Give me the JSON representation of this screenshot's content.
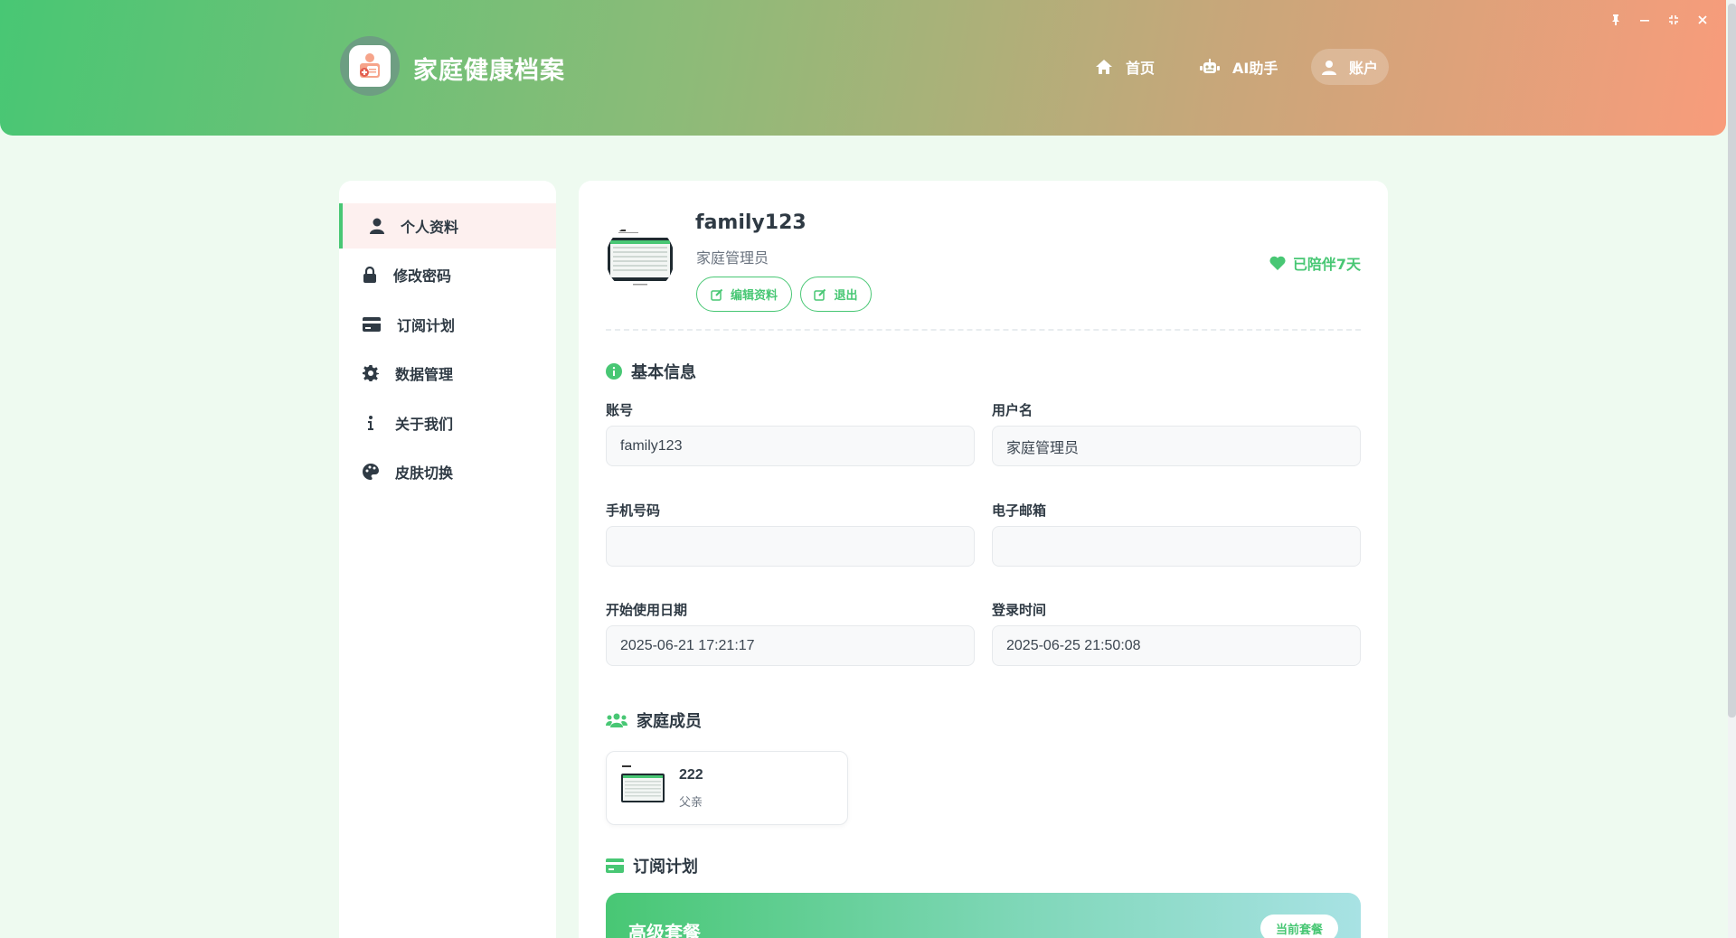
{
  "header": {
    "brand": "家庭健康档案",
    "nav": {
      "home": "首页",
      "ai": "AI助手",
      "account": "账户"
    },
    "window_controls": [
      "pin-icon",
      "minimize-icon",
      "restore-icon",
      "close-icon"
    ]
  },
  "sidebar": {
    "items": [
      {
        "label": "个人资料",
        "icon": "user-icon"
      },
      {
        "label": "修改密码",
        "icon": "lock-icon"
      },
      {
        "label": "订阅计划",
        "icon": "credit-card-icon"
      },
      {
        "label": "数据管理",
        "icon": "gear-icon"
      },
      {
        "label": "关于我们",
        "icon": "info-icon"
      },
      {
        "label": "皮肤切换",
        "icon": "palette-icon"
      }
    ]
  },
  "profile": {
    "username": "family123",
    "role": "家庭管理员",
    "edit_label": "编辑资料",
    "logout_label": "退出",
    "companion": "已陪伴7天"
  },
  "basic_info": {
    "title": "基本信息",
    "account_label": "账号",
    "account_value": "family123",
    "name_label": "用户名",
    "name_value": "家庭管理员",
    "phone_label": "手机号码",
    "phone_value": "",
    "email_label": "电子邮箱",
    "email_value": "",
    "start_label": "开始使用日期",
    "start_value": "2025-06-21 17:21:17",
    "login_label": "登录时间",
    "login_value": "2025-06-25 21:50:08"
  },
  "family": {
    "title": "家庭成员",
    "members": [
      {
        "name": "222",
        "relation": "父亲"
      }
    ]
  },
  "subscription": {
    "title": "订阅计划",
    "plan_name": "高级套餐",
    "badge": "当前套餐"
  },
  "colors": {
    "accent": "#48c774",
    "header_start": "#48c774",
    "header_end": "#f89c7b"
  }
}
